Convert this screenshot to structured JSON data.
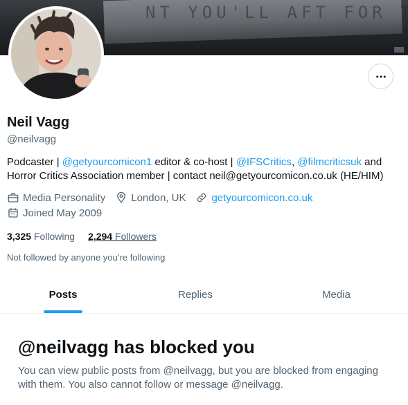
{
  "banner": {
    "scrawl": "NT YOU'LL AFT FOR THE"
  },
  "profile": {
    "name": "Neil Vagg",
    "handle": "@neilvagg",
    "bio": {
      "p1": "Podcaster | ",
      "m1": "@getyourcomicon1",
      "p2": " editor & co-host | ",
      "m2": "@IFSCritics",
      "p3": ", ",
      "m3": "@filmcriticsuk",
      "p4": " and Horror Critics Association member | contact neil@getyourcomicon.co.uk (HE/HIM)"
    },
    "category": "Media Personality",
    "location": "London, UK",
    "website": "getyourcomicon.co.uk",
    "joined": "Joined May 2009",
    "following_count": "3,325",
    "following_label": "Following",
    "followers_count": "2,294",
    "followers_label": "Followers",
    "not_followed": "Not followed by anyone you’re following"
  },
  "tabs": [
    {
      "label": "Posts",
      "active": true
    },
    {
      "label": "Replies",
      "active": false
    },
    {
      "label": "Media",
      "active": false
    }
  ],
  "blocked": {
    "title": "@neilvagg has blocked you",
    "text": "You can view public posts from @neilvagg, but you are blocked from engaging with them. You also cannot follow or message @neilvagg."
  },
  "icons": {
    "more": "more-horizontal-icon",
    "category": "briefcase-icon",
    "location": "map-pin-icon",
    "website": "link-icon",
    "joined": "calendar-icon"
  },
  "colors": {
    "accent": "#1d9bf0",
    "secondary_text": "#536471",
    "primary_text": "#0f1419"
  }
}
